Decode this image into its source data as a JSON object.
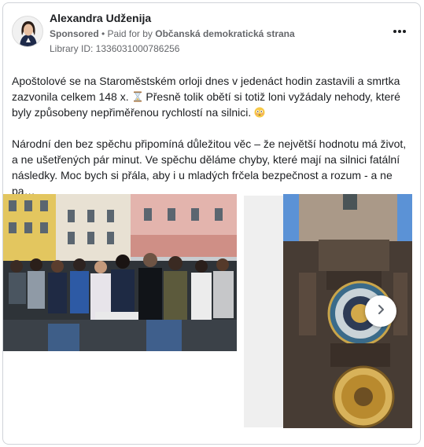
{
  "advertiser": {
    "name": "Alexandra Udženija",
    "sponsored_label": "Sponsored",
    "separator": " • ",
    "paid_for_prefix": "Paid for by ",
    "payer": "Občanská demokratická strana",
    "library_id": "Library ID: 1336031000786256"
  },
  "post": {
    "paragraph_1": "Apoštolové se na Staroměstském orloji dnes v jedenáct hodin zastavili a smrtka zazvonila celkem 148 x.",
    "paragraph_1b": "Přesně tolik obětí si totiž loni vyžádaly nehody, které byly způsobeny nepřiměřenou rychlostí na silnici.",
    "paragraph_2": "Národní den bez spěchu připomíná důležitou věc – že největší hodnotu má život, a ne ušetřených pár minut. Ve spěchu děláme chyby, které mají na silnici fatální následky. Moc bych si přála, aby i u mladých frčela bezpečnost a rozum - a ne pa…"
  },
  "icons": {
    "more": "more-horizontal-icon",
    "hourglass": "hourglass-emoji",
    "face": "flushed-face-emoji",
    "next": "chevron-right-icon"
  },
  "colors": {
    "text": "#1c1e21",
    "secondary_text": "#65676b",
    "border": "#d0d3d8"
  }
}
